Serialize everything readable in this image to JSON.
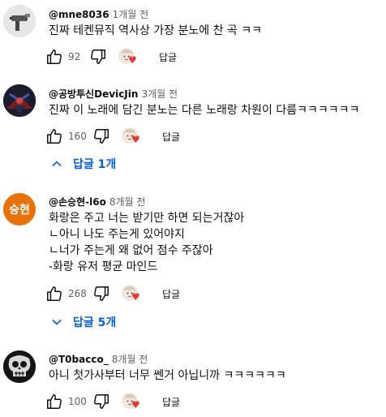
{
  "comments": [
    {
      "author": "@mne8036",
      "time": "1개월 전",
      "lines": [
        "진짜 테켄뮤직 역사상 가장 분노에 찬 곡 ㅋㅋ"
      ],
      "likes": "92",
      "reply_label": "답글",
      "avatar_icon": "spray-gun-avatar-icon"
    },
    {
      "author": "@공방투신DevicJin",
      "time": "3개월 전",
      "lines": [
        "진짜 이 노래에 담긴 분노는 다른 노래랑 차원이 다름ㅋㅋㅋㅋㅋㅋ"
      ],
      "likes": "160",
      "reply_label": "답글",
      "replies_label": "답글 1개",
      "avatar_icon": "devil-jin-avatar-icon"
    },
    {
      "author": "@손승현-l6o",
      "time": "8개월 전",
      "avatar_text": "승현",
      "lines": [
        "화랑은 주고 너는 받기만 하면 되는거잖아",
        "ㄴ아니 나도 주는게 있어야지",
        "ㄴ너가 주는게 왜 없어 점수 주잖아",
        "-화랑 유저 평균 마인드"
      ],
      "likes": "268",
      "reply_label": "답글",
      "replies_label": "답글 5개",
      "avatar_icon": "initials-avatar"
    },
    {
      "author": "@T0bacco_",
      "time": "8개월 전",
      "lines": [
        "아니 첫가사부터 너무 쎈거 아닙니까 ㅋㅋㅋㅋㅋㅋ"
      ],
      "likes": "100",
      "reply_label": "답글",
      "avatar_icon": "skull-avatar-icon"
    }
  ],
  "colors": {
    "link": "#065fd4",
    "secondary": "#606060",
    "heart": "#e53935",
    "avatar_orange": "#e8710a"
  }
}
